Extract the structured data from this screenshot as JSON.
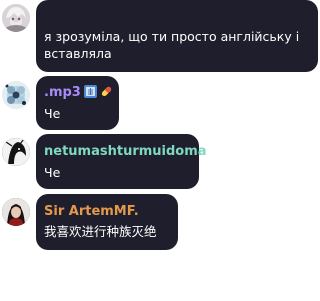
{
  "messages": [
    {
      "author": "",
      "text_line1": "я зрозуміла, що ти просто англійську і",
      "text_line2": "вставляла",
      "avatar_icon": "anime-girl-avatar-icon"
    },
    {
      "author": ".mp3",
      "author_color": "#a78bfa",
      "text": "Че",
      "avatar_icon": "flower-avatar-icon",
      "badges": [
        "x-ray-icon",
        "pill-icon"
      ]
    },
    {
      "author": "netumashturmuidoma",
      "author_color": "#7fd8c0",
      "text": "Че",
      "avatar_icon": "dark-figure-avatar-icon"
    },
    {
      "author": "Sir ArtemMF.",
      "author_color": "#e39a4c",
      "text": "我喜欢进行种族灭绝",
      "avatar_icon": "portrait-avatar-icon"
    }
  ]
}
